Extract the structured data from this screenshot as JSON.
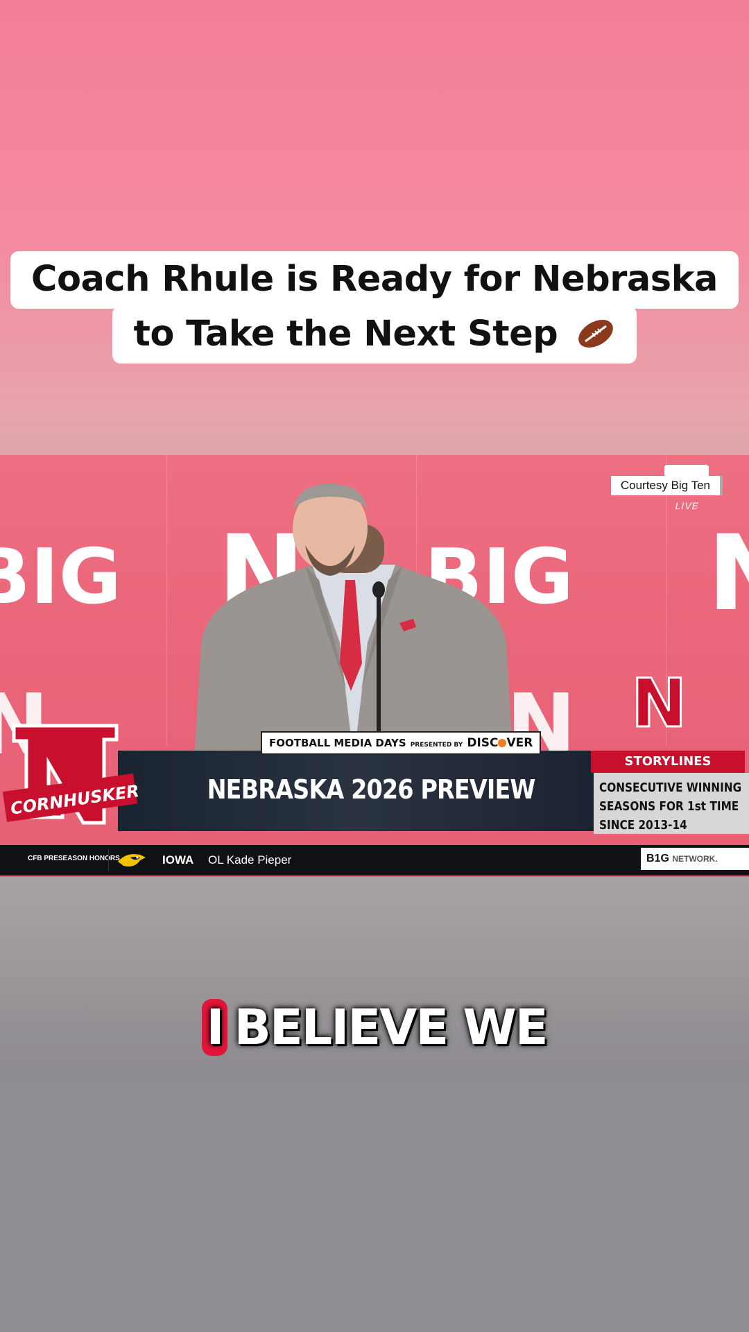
{
  "title": {
    "line1": "Coach Rhule is Ready for Nebraska",
    "line2": "to Take the Next Step"
  },
  "video": {
    "courtesy": "Courtesy Big Ten",
    "live": "LIVE",
    "bg_logo_1": "BIG",
    "bg_logo_2": "N",
    "lower_third": {
      "event_label": "FOOTBALL MEDIA DAYS",
      "presented_by": "PRESENTED BY",
      "sponsor": "DISC",
      "sponsor_end": "VER",
      "headline": "NEBRASKA 2026 PREVIEW",
      "logo_text": "CORNHUSKERS",
      "storylines_label": "STORYLINES",
      "storylines_lines": [
        "CONSECUTIVE WINNING",
        "SEASONS FOR 1st TIME",
        "SINCE 2013-14"
      ]
    },
    "ticker": {
      "label": "CFB PRESEASON HONORS",
      "team": "IOWA",
      "player": "OL Kade Pieper",
      "network": "B1G",
      "network_suffix": "NETWORK."
    }
  },
  "caption": {
    "highlight": "I",
    "rest": "BELIEVE WE"
  },
  "colors": {
    "nebraska_red": "#c8102e",
    "caption_highlight": "#e3163a",
    "backdrop_pink": "#ea6579"
  }
}
